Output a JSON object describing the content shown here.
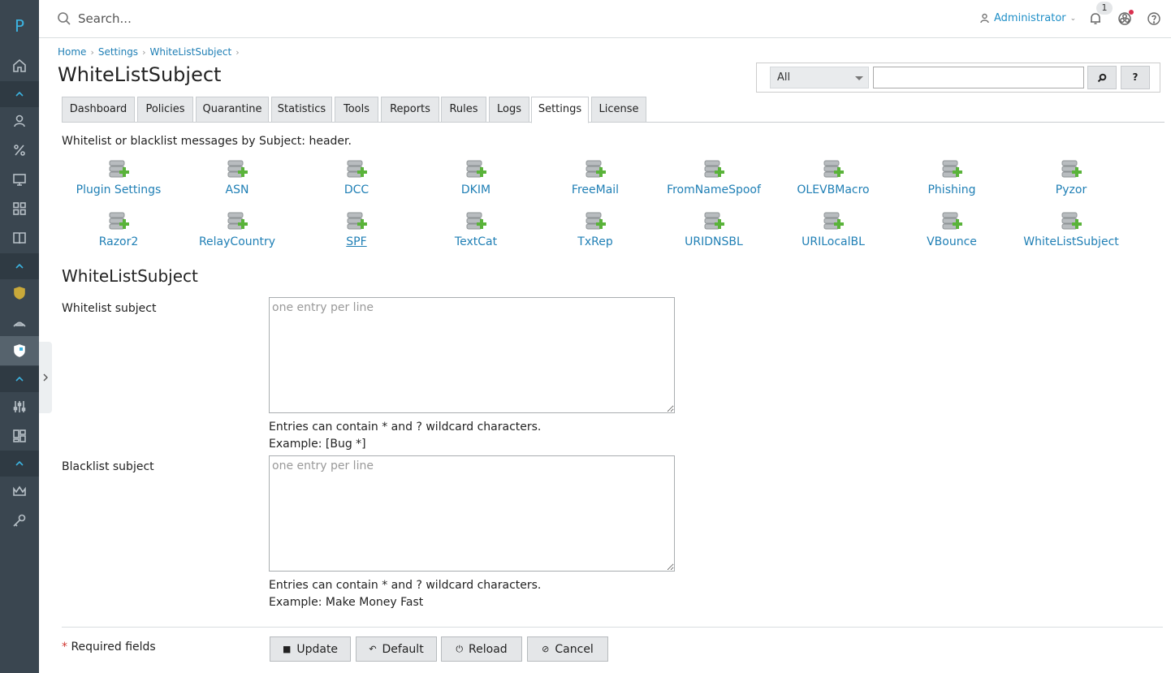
{
  "sidebar": {
    "logo": "P",
    "items": [
      "home-icon",
      "users-icon",
      "percent-icon",
      "monitor-icon",
      "grid-icon",
      "book-icon",
      "shield-gold-icon",
      "spider-icon",
      "shield-flag-icon",
      "sliders-icon",
      "layout-icon",
      "crown-icon",
      "key-icon"
    ]
  },
  "header": {
    "search_placeholder": "Search...",
    "user": "Administrator",
    "notification_count": "1"
  },
  "breadcrumb": [
    "Home",
    "Settings",
    "WhiteListSubject"
  ],
  "page_title": "WhiteListSubject",
  "filter": {
    "select_value": "All",
    "help_label": "?"
  },
  "tabs": [
    "Dashboard",
    "Policies",
    "Quarantine",
    "Statistics",
    "Tools",
    "Reports",
    "Rules",
    "Logs",
    "Settings",
    "License"
  ],
  "active_tab": "Settings",
  "description": "Whitelist or blacklist messages by Subject: header.",
  "plugins": [
    "Plugin Settings",
    "ASN",
    "DCC",
    "DKIM",
    "FreeMail",
    "FromNameSpoof",
    "OLEVBMacro",
    "Phishing",
    "Pyzor",
    "Razor2",
    "RelayCountry",
    "SPF",
    "TextCat",
    "TxRep",
    "URIDNSBL",
    "URILocalBL",
    "VBounce",
    "WhiteListSubject"
  ],
  "section_title": "WhiteListSubject",
  "fields": {
    "whitelist": {
      "label": "Whitelist subject",
      "placeholder": "one entry per line",
      "hint1": "Entries can contain * and ? wildcard characters.",
      "hint2": "Example: [Bug *]"
    },
    "blacklist": {
      "label": "Blacklist subject",
      "placeholder": "one entry per line",
      "hint1": "Entries can contain * and ? wildcard characters.",
      "hint2": "Example: Make Money Fast"
    }
  },
  "footer": {
    "required_star": "*",
    "required_text": " Required fields",
    "buttons": {
      "update": "Update",
      "default": "Default",
      "reload": "Reload",
      "cancel": "Cancel"
    }
  },
  "colors": {
    "sidebar_bg": "#3a4650",
    "link": "#1f7fb5",
    "accent": "#3cb3e0"
  }
}
